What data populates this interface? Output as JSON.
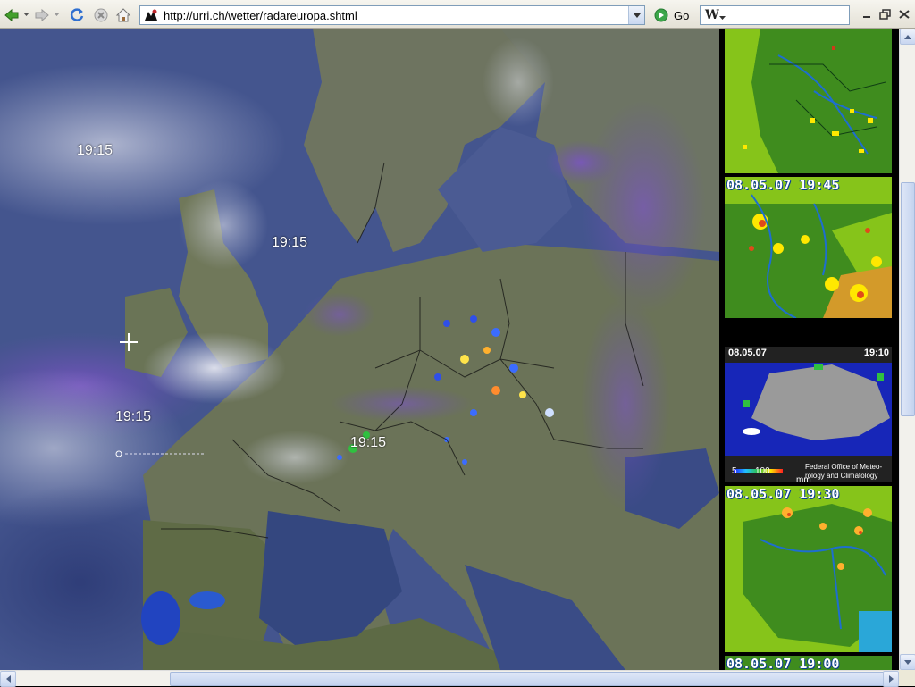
{
  "browser": {
    "address": {
      "url": "http://urri.ch/wetter/radareuropa.shtml"
    },
    "go_label": "Go",
    "search": {
      "engine_letter": "W",
      "value": ""
    }
  },
  "map": {
    "time_labels": [
      "19:15",
      "19:15",
      "19:15",
      "19:15"
    ]
  },
  "side_panel": {
    "benelux_map": {
      "caption": ""
    },
    "germany_map": {
      "caption": "08.05.07 19:45"
    },
    "swiss_map": {
      "date": "08.05.07",
      "time": "19:10",
      "legend_low": "5",
      "legend_high": "100",
      "unit": "mm",
      "credit": "Federal Office of Meteo-rology and Climatology"
    },
    "france_map": {
      "caption": "08.05.07 19:30"
    },
    "bottom_map": {
      "caption": "08.05.07 19:00"
    }
  },
  "colors": {
    "sea": "#3e4f86",
    "land": "#6b7358",
    "cloud_high": "#d9dcea",
    "cloud_purple": "#6a4fb0",
    "radar_green": "#3f8c1e",
    "radar_lime": "#86c41a"
  }
}
